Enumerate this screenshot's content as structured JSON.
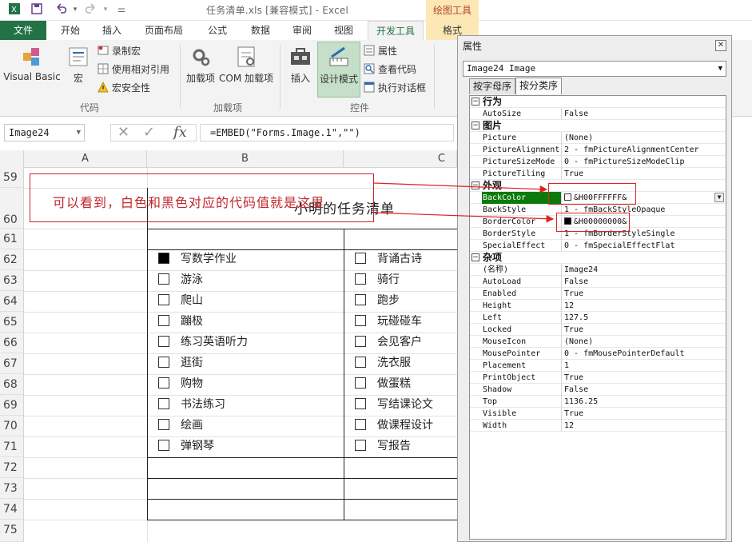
{
  "titlebar": {
    "title": "任务清单.xls  [兼容模式] - Excel",
    "context_tool": "绘图工具"
  },
  "tabs": [
    "文件",
    "开始",
    "插入",
    "页面布局",
    "公式",
    "数据",
    "审阅",
    "视图",
    "开发工具",
    "格式"
  ],
  "ribbon": {
    "visual_basic": "Visual Basic",
    "macros": "宏",
    "record_macro": "录制宏",
    "use_relative": "使用相对引用",
    "macro_security": "宏安全性",
    "group_code": "代码",
    "addins": "加载项",
    "com_addins": "COM 加载项",
    "group_addins": "加载项",
    "insert": "插入",
    "design_mode": "设计模式",
    "properties": "属性",
    "view_code": "查看代码",
    "run_dialog": "执行对话框",
    "group_controls": "控件"
  },
  "formula": {
    "name_box": "Image24",
    "content": "=EMBED(\"Forms.Image.1\",\"\")"
  },
  "grid": {
    "columns": [
      "A",
      "B",
      "C"
    ],
    "rows": [
      "59",
      "60",
      "61",
      "62",
      "63",
      "64",
      "65",
      "66",
      "67",
      "68",
      "69",
      "70",
      "71",
      "72",
      "73",
      "74",
      "75"
    ],
    "sheet_title": "小明的任务清单",
    "annotation": "可以看到，白色和黑色对应的代码值就是这里",
    "tasks_left": [
      {
        "label": "写数学作业",
        "checked": true
      },
      {
        "label": "游泳",
        "checked": false
      },
      {
        "label": "爬山",
        "checked": false
      },
      {
        "label": "蹦极",
        "checked": false
      },
      {
        "label": "练习英语听力",
        "checked": false
      },
      {
        "label": "逛街",
        "checked": false
      },
      {
        "label": "购物",
        "checked": false
      },
      {
        "label": "书法练习",
        "checked": false
      },
      {
        "label": "绘画",
        "checked": false
      },
      {
        "label": "弹钢琴",
        "checked": false
      }
    ],
    "tasks_right": [
      {
        "label": "背诵古诗",
        "checked": false
      },
      {
        "label": "骑行",
        "checked": false
      },
      {
        "label": "跑步",
        "checked": false
      },
      {
        "label": "玩碰碰车",
        "checked": false
      },
      {
        "label": "会见客户",
        "checked": false
      },
      {
        "label": "洗衣服",
        "checked": false
      },
      {
        "label": "做蛋糕",
        "checked": false
      },
      {
        "label": "写结课论文",
        "checked": false
      },
      {
        "label": "做课程设计",
        "checked": false
      },
      {
        "label": "写报告",
        "checked": false
      }
    ]
  },
  "properties": {
    "title": "属性",
    "close": "✕",
    "object": "Image24 Image",
    "tab_alpha": "按字母序",
    "tab_category": "按分类序",
    "rows": [
      {
        "cat": true,
        "name": "行为"
      },
      {
        "name": "AutoSize",
        "value": "False"
      },
      {
        "cat": true,
        "name": "图片"
      },
      {
        "name": "Picture",
        "value": "(None)"
      },
      {
        "name": "PictureAlignment",
        "value": "2 - fmPictureAlignmentCenter"
      },
      {
        "name": "PictureSizeMode",
        "value": "0 - fmPictureSizeModeClip"
      },
      {
        "name": "PictureTiling",
        "value": "True"
      },
      {
        "cat": true,
        "name": "外观"
      },
      {
        "name": "BackColor",
        "value": "&H00FFFFFF&",
        "swatch": "#ffffff",
        "selected": true
      },
      {
        "name": "BackStyle",
        "value": "1 - fmBackStyleOpaque"
      },
      {
        "name": "BorderColor",
        "value": "&H00000000&",
        "swatch": "#000000"
      },
      {
        "name": "BorderStyle",
        "value": "1 - fmBorderStyleSingle"
      },
      {
        "name": "SpecialEffect",
        "value": "0 - fmSpecialEffectFlat"
      },
      {
        "cat": true,
        "name": "杂项"
      },
      {
        "name": "(名称)",
        "value": "Image24"
      },
      {
        "name": "AutoLoad",
        "value": "False"
      },
      {
        "name": "Enabled",
        "value": "True"
      },
      {
        "name": "Height",
        "value": "12"
      },
      {
        "name": "Left",
        "value": "127.5"
      },
      {
        "name": "Locked",
        "value": "True"
      },
      {
        "name": "MouseIcon",
        "value": "(None)"
      },
      {
        "name": "MousePointer",
        "value": "0 - fmMousePointerDefault"
      },
      {
        "name": "Placement",
        "value": "1"
      },
      {
        "name": "PrintObject",
        "value": "True"
      },
      {
        "name": "Shadow",
        "value": "False"
      },
      {
        "name": "Top",
        "value": "1136.25"
      },
      {
        "name": "Visible",
        "value": "True"
      },
      {
        "name": "Width",
        "value": "12"
      }
    ]
  },
  "icons": {
    "save": "save-icon",
    "undo": "undo-icon",
    "redo": "redo-icon"
  },
  "colors": {
    "excel_green": "#217346",
    "annotation_red": "#c0262d",
    "selected_property": "#0b7a0b"
  }
}
